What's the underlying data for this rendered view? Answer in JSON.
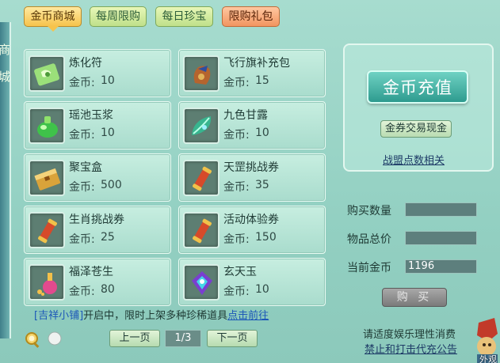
{
  "left_strip": {
    "chars": [
      "商",
      "城"
    ]
  },
  "tabs": [
    {
      "label": "金币商城",
      "state": "active"
    },
    {
      "label": "每周限购",
      "state": "normal"
    },
    {
      "label": "每日珍宝",
      "state": "normal"
    },
    {
      "label": "限购礼包",
      "state": "sale"
    }
  ],
  "price_prefix": "金币:",
  "items": [
    {
      "name": "炼化符",
      "price": "10",
      "icon": "talisman-icon"
    },
    {
      "name": "飞行旗补充包",
      "price": "15",
      "icon": "flag-pack-icon"
    },
    {
      "name": "瑶池玉浆",
      "price": "10",
      "icon": "jade-liquid-icon"
    },
    {
      "name": "九色甘露",
      "price": "10",
      "icon": "nectar-leaf-icon"
    },
    {
      "name": "聚宝盒",
      "price": "500",
      "icon": "treasure-box-icon"
    },
    {
      "name": "天罡挑战券",
      "price": "35",
      "icon": "scroll-icon"
    },
    {
      "name": "生肖挑战券",
      "price": "25",
      "icon": "scroll-icon"
    },
    {
      "name": "活动体验券",
      "price": "150",
      "icon": "scroll-icon"
    },
    {
      "name": "福泽苍生",
      "price": "80",
      "icon": "potion-icon"
    },
    {
      "name": "玄天玉",
      "price": "10",
      "icon": "mystic-jade-icon"
    }
  ],
  "recharge": {
    "button": "金币充值",
    "exchange": "金券交易现金",
    "alliance_link": "战盟点数相关"
  },
  "purchase_form": {
    "qty_label": "购买数量",
    "qty_value": "",
    "total_label": "物品总价",
    "total_value": "",
    "gold_label": "当前金币",
    "gold_value": "1196",
    "buy_button": "购 买"
  },
  "notice": {
    "shop_name": "[吉祥小铺]",
    "text": "开启中，限时上架多种珍稀道具",
    "link": "点击前往"
  },
  "pager": {
    "prev": "上一页",
    "page": "1/3",
    "next": "下一页"
  },
  "footer": {
    "line1": "请适度娱乐理性消费",
    "line2": "禁止和打击代充公告"
  },
  "corner": {
    "label": "外观"
  },
  "colors": {
    "background": "#a7dccf",
    "active_tab": "#f6c34c",
    "sale_tab": "#f29560",
    "recharge_button": "#2e9b8f",
    "link_blue": "#1c57b8"
  }
}
